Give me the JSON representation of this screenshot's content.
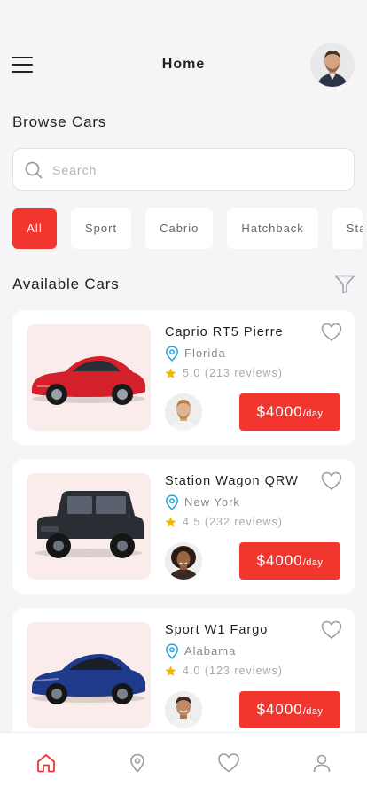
{
  "header": {
    "title": "Home"
  },
  "browse": {
    "title": "Browse Cars"
  },
  "search": {
    "placeholder": "Search"
  },
  "categories": [
    {
      "label": "All",
      "active": true
    },
    {
      "label": "Sport",
      "active": false
    },
    {
      "label": "Cabrio",
      "active": false
    },
    {
      "label": "Hatchback",
      "active": false
    },
    {
      "label": "Sta",
      "active": false
    }
  ],
  "available": {
    "title": "Available Cars"
  },
  "cars": [
    {
      "name": "Caprio RT5 Pierre",
      "location": "Florida",
      "rating": "5.0 (213 reviews)",
      "price": "$4000",
      "per": "/day",
      "color": "#d4202a"
    },
    {
      "name": "Station Wagon QRW",
      "location": "New York",
      "rating": "4.5 (232 reviews)",
      "price": "$4000",
      "per": "/day",
      "color": "#2a2d33"
    },
    {
      "name": "Sport W1 Fargo",
      "location": "Alabama",
      "rating": "4.0 (123 reviews)",
      "price": "$4000",
      "per": "/day",
      "color": "#1f3a8a"
    }
  ],
  "colors": {
    "accent": "#f0362f",
    "location_icon": "#29a8e0",
    "star": "#f5b400",
    "background": "#f5f5f7"
  },
  "icons": {
    "menu": "hamburger-icon",
    "search": "search-icon",
    "filter": "filter-icon",
    "favorite": "heart-icon",
    "location": "location-pin-icon",
    "rating": "star-icon",
    "tabs": [
      "home-icon",
      "map-pin-icon",
      "heart-icon",
      "user-icon"
    ]
  }
}
